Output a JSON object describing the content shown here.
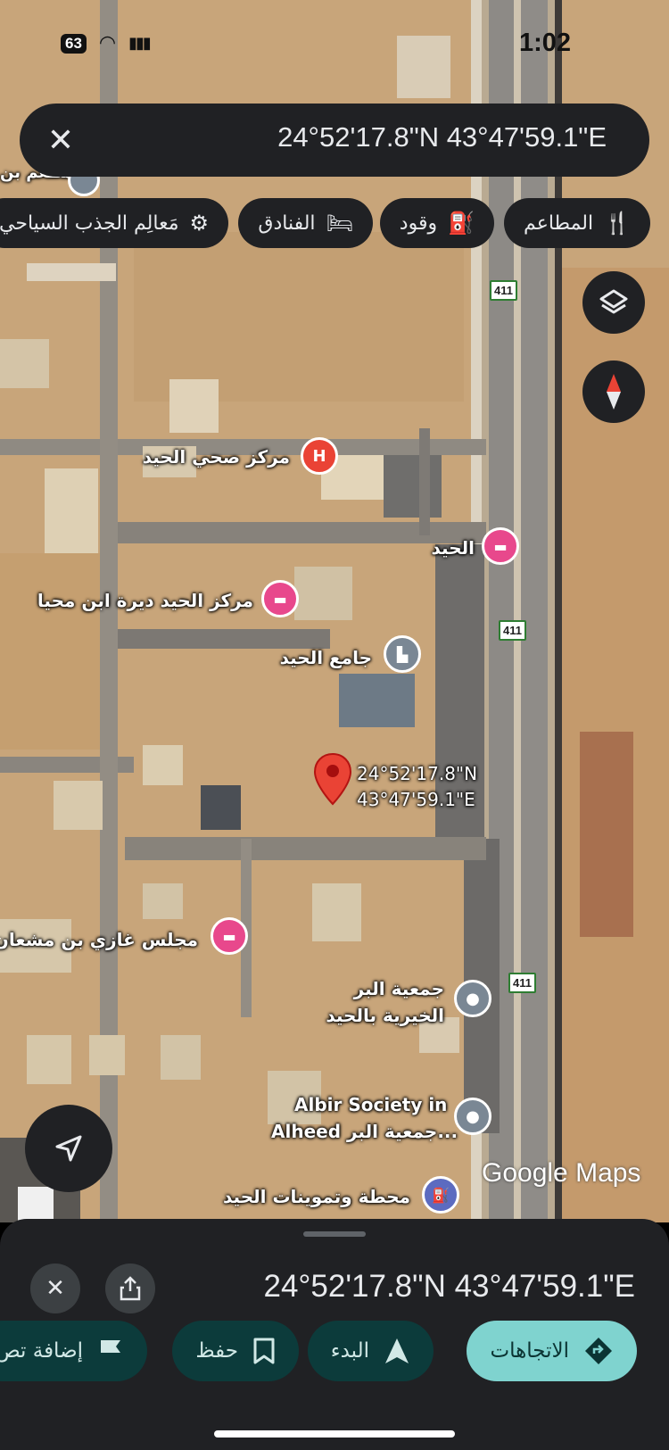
{
  "status_bar": {
    "time": "1:02",
    "battery": "63"
  },
  "search": {
    "query": "24°52'17.8\"N 43°47'59.1\"E"
  },
  "chips": [
    {
      "label": "المطاعم",
      "icon": "restaurant-icon"
    },
    {
      "label": "وقود",
      "icon": "gas-station-icon"
    },
    {
      "label": "الفنادق",
      "icon": "hotel-icon"
    },
    {
      "label": "مَعالِم الجذب السياحي",
      "icon": "attraction-icon"
    }
  ],
  "map": {
    "labels": {
      "health_center": "مركز صحي الحيد",
      "alheed_hotel": "الحيد",
      "center_dirah": "مركز الحيد ديرة ابن محيا",
      "mosque": "جامع الحيد",
      "dropped_pin_line1": "24°52'17.8\"N",
      "dropped_pin_line2": "43°47'59.1\"E",
      "majlis": "مجلس غازي بن مشعان",
      "charity_line1": "جمعية البر",
      "charity_line2": "الخيرية بالحيد",
      "albir_line1": "Albir Society in",
      "albir_line2": "Alheed جمعية البر...",
      "station": "محطة وتموينات الحيد",
      "top_left_partial": "مطعم بن"
    },
    "road_number": "411",
    "health_letter": "H",
    "attribution": "Google Maps"
  },
  "sheet": {
    "coords": "24°52'17.8\"N 43°47'59.1\"E",
    "buttons": {
      "directions": "الاتجاهات",
      "start": "البدء",
      "save": "حفظ",
      "add": "إضافة تص"
    }
  },
  "colors": {
    "sheet_bg": "#202124",
    "primary_btn": "#7fd3cf",
    "dark_btn": "#0c3b3b",
    "pin_red": "#ea4335",
    "hotel_pink": "#e8488c",
    "poi_gray": "#7a8794"
  }
}
